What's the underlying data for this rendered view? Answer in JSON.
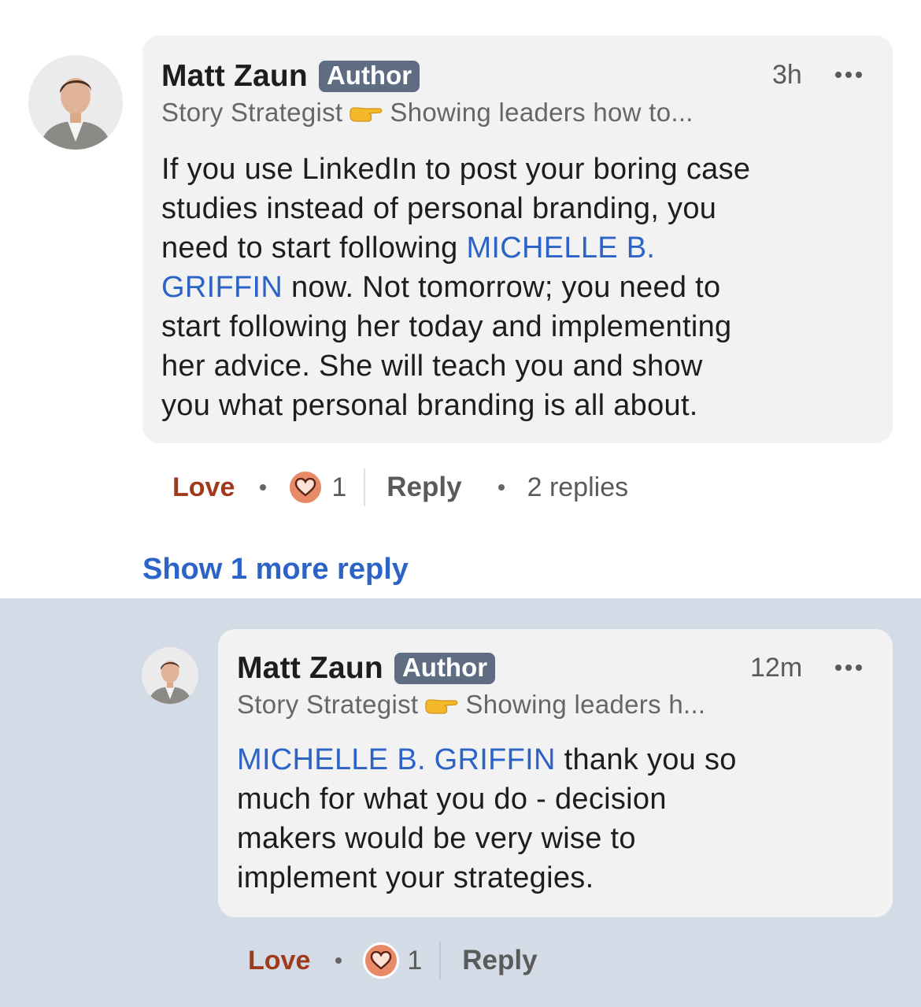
{
  "comment": {
    "author": "Matt Zaun",
    "badge": "Author",
    "time": "3h",
    "headline_prefix": "Story Strategist",
    "headline_suffix": "Showing leaders how to...",
    "body_lines": [
      "If you use LinkedIn to post your boring case",
      "studies instead of personal branding, you",
      "need to start following ",
      "MICHELLE B.",
      "GRIFFIN",
      " now.  Not tomorrow; you need to",
      "start following her today and implementing",
      "her advice.  She will teach you and show",
      "you what personal branding is all about."
    ],
    "reaction_label": "Love",
    "reaction_count": "1",
    "reply_label": "Reply",
    "replies_count": "2 replies"
  },
  "show_more": "Show 1 more reply",
  "reply": {
    "author": "Matt Zaun",
    "badge": "Author",
    "time": "12m",
    "headline_prefix": "Story Strategist",
    "headline_suffix": "Showing leaders h...",
    "mention": "MICHELLE B. GRIFFIN",
    "body_lines": [
      " thank you so",
      "much for what you do - decision",
      "makers would be very wise to",
      "implement your strategies."
    ],
    "reaction_label": "Love",
    "reaction_count": "1",
    "reply_label": "Reply"
  },
  "colors": {
    "mention": "#2b63c6",
    "love": "#a03a1a",
    "badge": "#5e6d82",
    "reply_band": "#d3dce6",
    "bubble": "#f2f2f2"
  },
  "icons": [
    "avatar-photo",
    "backhand-index-pointing-right",
    "heart-icon",
    "more-icon"
  ]
}
